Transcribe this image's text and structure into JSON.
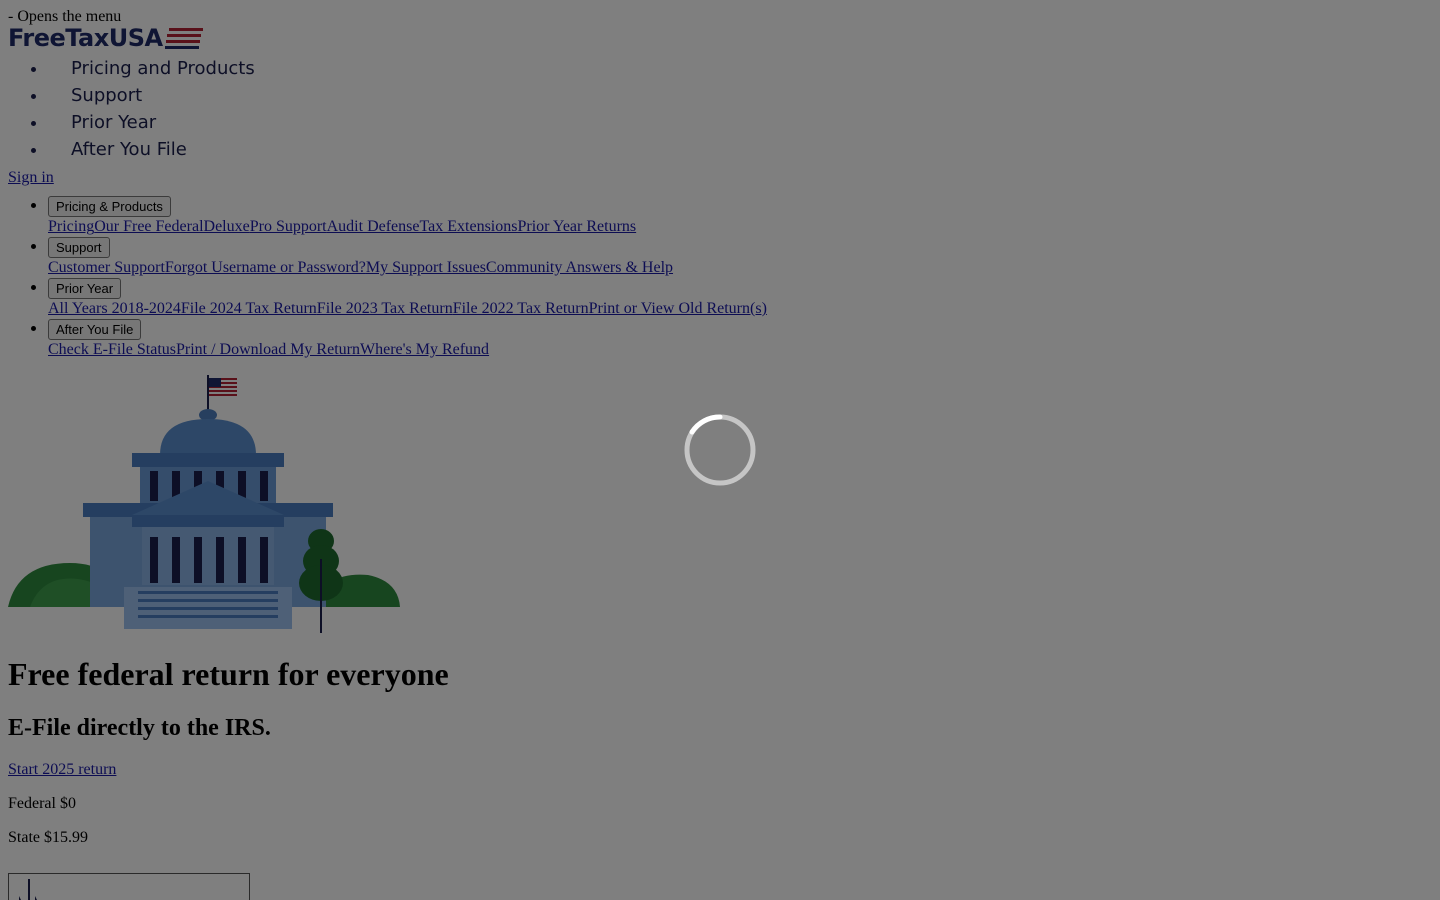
{
  "skip_link": "- Opens the menu",
  "logo": {
    "text": "FreeTaxUSA",
    "brand_color": "#1f2a68",
    "stripe_color": "#b22234"
  },
  "main_nav": [
    {
      "label": "Pricing and Products"
    },
    {
      "label": "Support"
    },
    {
      "label": "Prior Year"
    },
    {
      "label": "After You File"
    }
  ],
  "signin": "Sign in",
  "mega_menu": [
    {
      "button": "Pricing & Products",
      "links": [
        "Pricing",
        "Our Free Federal",
        "Deluxe",
        "Pro Support",
        "Audit Defense",
        "Tax Extensions",
        "Prior Year Returns"
      ]
    },
    {
      "button": "Support",
      "links": [
        "Customer Support",
        "Forgot Username or Password?",
        "My Support Issues",
        "Community Answers & Help"
      ]
    },
    {
      "button": "Prior Year",
      "links": [
        "All Years 2018-2024",
        "File 2024 Tax Return",
        "File 2023 Tax Return",
        "File 2022 Tax Return",
        "Print or View Old Return(s)"
      ]
    },
    {
      "button": "After You File",
      "links": [
        "Check E-File Status",
        "Print / Download My Return",
        "Where's My Refund"
      ]
    }
  ],
  "hero": {
    "title": "Free federal return for everyone",
    "subtitle": "E-File directly to the IRS.",
    "cta": "Start 2025 return",
    "federal_price": "Federal $0",
    "state_price": "State $15.99"
  },
  "overlay": {
    "color": "rgba(0,0,0,0.5)",
    "spinner_icon": "loading-spinner-icon"
  }
}
